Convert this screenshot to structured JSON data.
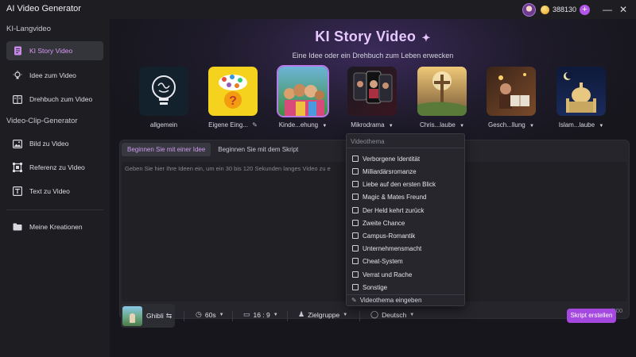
{
  "window": {
    "title": "AI Video Generator",
    "credits": "388130"
  },
  "sidebar": {
    "section1": "KI-Langvideo",
    "items1": [
      {
        "label": "KI Story Video",
        "icon": "story-icon",
        "active": true
      },
      {
        "label": "Idee zum Video",
        "icon": "bulb-icon"
      },
      {
        "label": "Drehbuch zum Video",
        "icon": "script-icon"
      }
    ],
    "section2": "Video-Clip-Generator",
    "items2": [
      {
        "label": "Bild zu Video",
        "icon": "image-icon"
      },
      {
        "label": "Referenz zu Video",
        "icon": "reference-icon"
      },
      {
        "label": "Text zu Video",
        "icon": "text-icon"
      }
    ],
    "my_creations": "Meine Kreationen"
  },
  "hero": {
    "title": "KI Story Video",
    "subtitle": "Eine Idee oder ein Drehbuch zum Leben erwecken"
  },
  "templates": [
    {
      "label": "allgemein"
    },
    {
      "label": "Eigene Eing..."
    },
    {
      "label": "Kinde...ehung"
    },
    {
      "label": "Mikrodrama"
    },
    {
      "label": "Chris...laube"
    },
    {
      "label": "Gesch...llung"
    },
    {
      "label": "Islam...laube"
    }
  ],
  "editor": {
    "tab_idea": "Beginnen Sie mit einer Idee",
    "tab_script": "Beginnen Sie mit dem Skript",
    "placeholder": "Geben Sie hier Ihre Ideen ein, um ein 30 bis 120 Sekunden langes Video zu e",
    "counter": "0/500"
  },
  "toolbar": {
    "style": "Ghibli",
    "duration": "60s",
    "ratio": "16 : 9",
    "audience": "Zielgruppe",
    "language": "Deutsch",
    "create": "Skript erstellen"
  },
  "dropdown": {
    "title": "Videothema",
    "items": [
      "Verborgene Identität",
      "Milliardärsromanze",
      "Liebe auf den ersten Blick",
      "Magic & Mates Freund",
      "Der Held kehrt zurück",
      "Zweite Chance",
      "Campus-Romantik",
      "Unternehmensmacht",
      "Cheat-System",
      "Verrat und Rache",
      "Sonstige"
    ],
    "custom": "Videothema eingeben"
  },
  "colors": {
    "accent": "#a448e0",
    "accent_text": "#d79af5"
  }
}
